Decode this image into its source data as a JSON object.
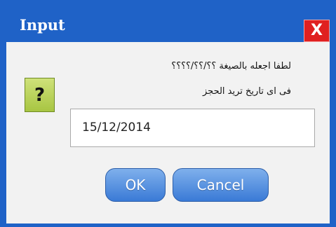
{
  "window": {
    "title": "Input",
    "close_label": "X"
  },
  "icon": {
    "name": "question-icon",
    "glyph": "?"
  },
  "message": {
    "line1": "لطفا اجعله بالصيغة ؟؟/؟؟/؟؟؟؟",
    "line2": "فى اى تاريخ تريد الحجز"
  },
  "input": {
    "value": "15/12/2014"
  },
  "buttons": {
    "ok_label": "OK",
    "cancel_label": "Cancel"
  },
  "colors": {
    "titlebar": "#1f62c7",
    "close_button": "#e02020",
    "icon_green": "#a8c542",
    "button_blue": "#3a7ad6"
  }
}
